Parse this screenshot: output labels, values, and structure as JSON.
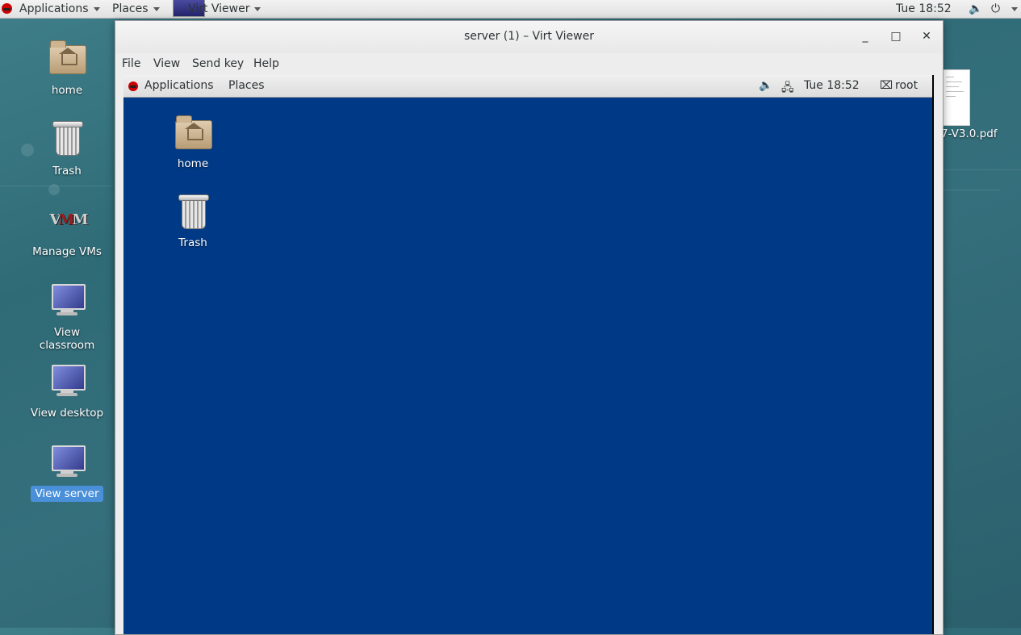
{
  "host_topbar": {
    "applications": "Applications",
    "places": "Places",
    "app_name": "Virt Viewer",
    "clock": "Tue 18:52",
    "volume_icon": "volume-icon",
    "power_icon": "power-icon"
  },
  "host_desktop": {
    "icons": [
      {
        "label": "home",
        "icon": "home-folder-icon"
      },
      {
        "label": "Trash",
        "icon": "trash-icon"
      },
      {
        "label": "Manage VMs",
        "icon": "virt-manager-icon"
      },
      {
        "label": "View classroom",
        "icon": "monitor-icon"
      },
      {
        "label": "View desktop",
        "icon": "monitor-icon"
      },
      {
        "label": "View server",
        "icon": "monitor-icon",
        "selected": true
      }
    ],
    "pdf_label": "7-V3.0.pdf"
  },
  "window": {
    "title": "server (1) – Virt Viewer",
    "minimize": "_",
    "maximize": "□",
    "close": "✕",
    "menu": [
      "File",
      "View",
      "Send key",
      "Help"
    ]
  },
  "guest": {
    "topbar": {
      "applications": "Applications",
      "places": "Places",
      "clock": "Tue 18:52",
      "user": "root"
    },
    "icons": [
      {
        "label": "home",
        "icon": "home-folder-icon"
      },
      {
        "label": "Trash",
        "icon": "trash-icon"
      }
    ],
    "background_color": "#003a87"
  }
}
